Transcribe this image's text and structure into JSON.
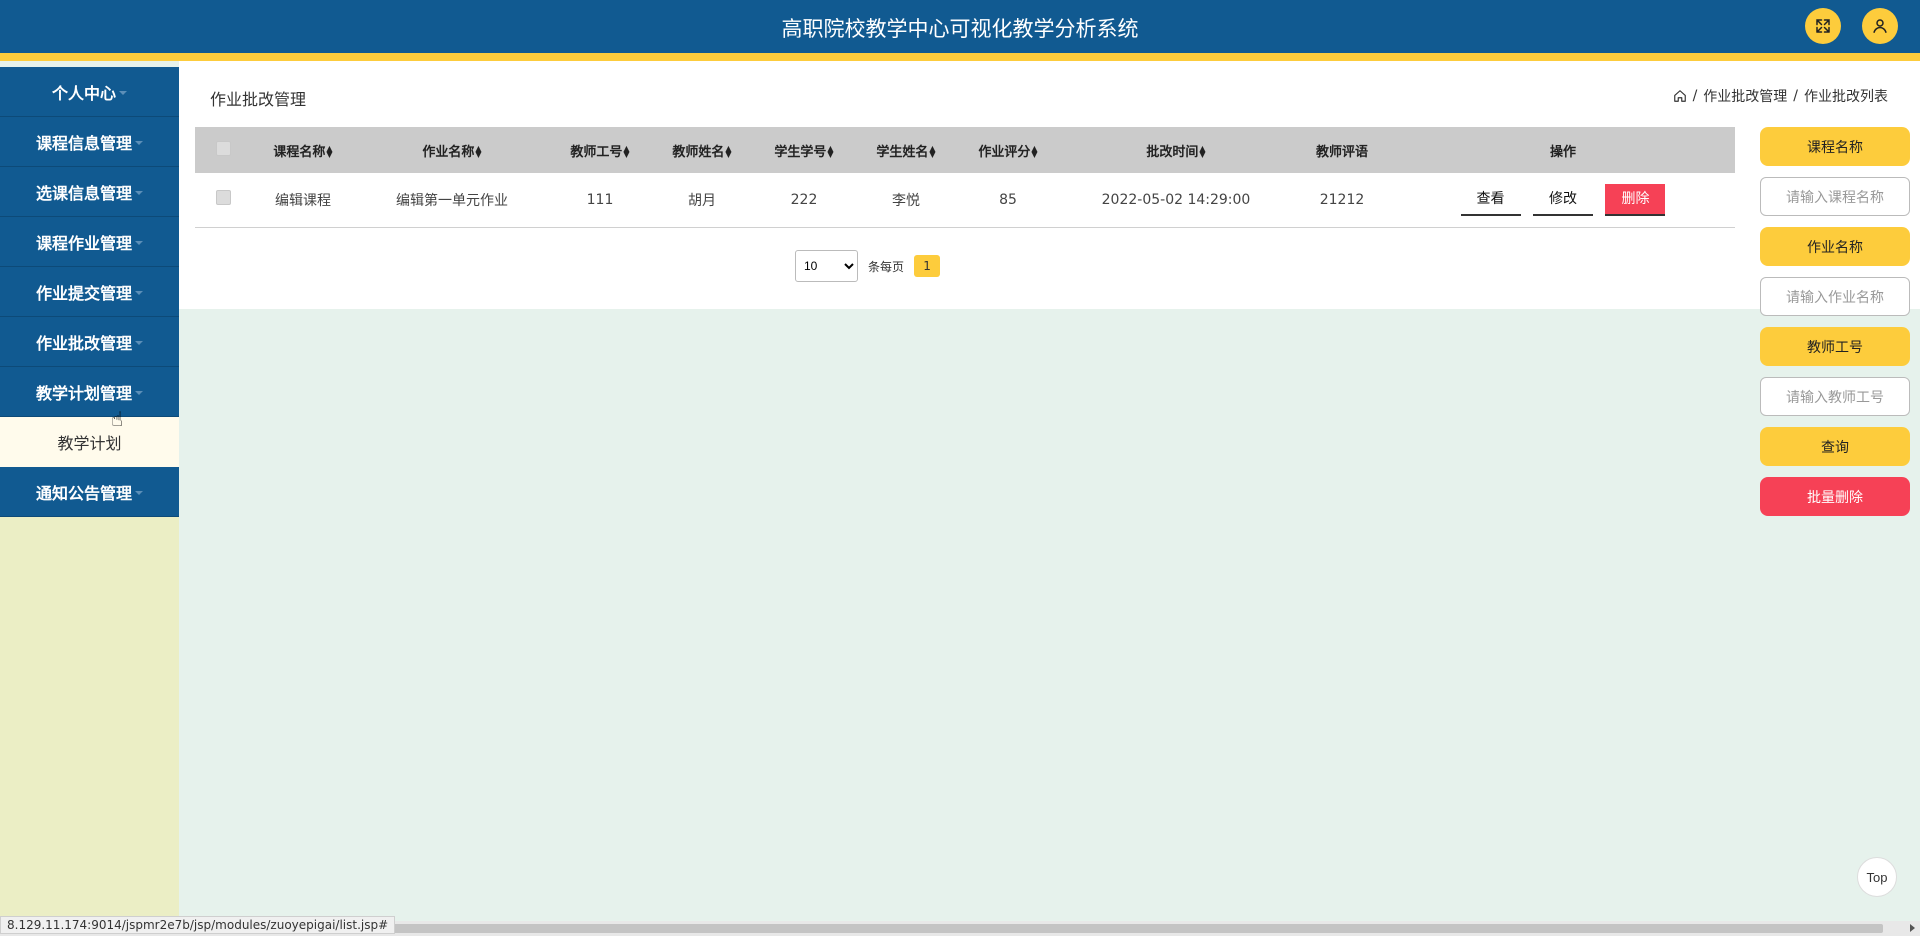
{
  "header": {
    "title": "高职院校教学中心可视化教学分析系统",
    "fullscreen_icon": "fullscreen-icon",
    "user_icon": "user-icon",
    "accent": "#fdcc3c",
    "bar_color": "#115a91"
  },
  "sidebar": {
    "items": [
      {
        "label": "个人中心",
        "has_caret": true
      },
      {
        "label": "课程信息管理",
        "has_caret": true
      },
      {
        "label": "选课信息管理",
        "has_caret": true
      },
      {
        "label": "课程作业管理",
        "has_caret": true
      },
      {
        "label": "作业提交管理",
        "has_caret": true
      },
      {
        "label": "作业批改管理",
        "has_caret": true
      },
      {
        "label": "教学计划管理",
        "has_caret": true
      },
      {
        "label": "教学计划",
        "has_caret": false
      },
      {
        "label": "通知公告管理",
        "has_caret": true
      }
    ]
  },
  "page": {
    "heading": "作业批改管理",
    "breadcrumb": [
      "作业批改管理",
      "作业批改列表"
    ],
    "separator": "/"
  },
  "table": {
    "columns": [
      "课程名称",
      "作业名称",
      "教师工号",
      "教师姓名",
      "学生学号",
      "学生姓名",
      "作业评分",
      "批改时间",
      "教师评语",
      "操作"
    ],
    "rows": [
      {
        "course_name": "编辑课程",
        "homework_name": "编辑第一单元作业",
        "teacher_id": "111",
        "teacher_name": "胡月",
        "student_id": "222",
        "student_name": "李悦",
        "score": "85",
        "review_time": "2022-05-02 14:29:00",
        "comment": "21212",
        "actions": {
          "view": "查看",
          "edit": "修改",
          "delete": "删除"
        }
      }
    ]
  },
  "pagination": {
    "page_size": "10",
    "page_size_label": "条每页",
    "current_page": "1"
  },
  "search": {
    "course_label": "课程名称",
    "course_placeholder": "请输入课程名称",
    "homework_label": "作业名称",
    "homework_placeholder": "请输入作业名称",
    "teacher_label": "教师工号",
    "teacher_placeholder": "请输入教师工号",
    "query_button": "查询",
    "batch_delete_button": "批量删除"
  },
  "top_button": "Top",
  "status_bar": {
    "url": "8.129.11.174:9014/jspmr2e7b/jsp/modules/zuoyepigai/list.jsp#"
  }
}
